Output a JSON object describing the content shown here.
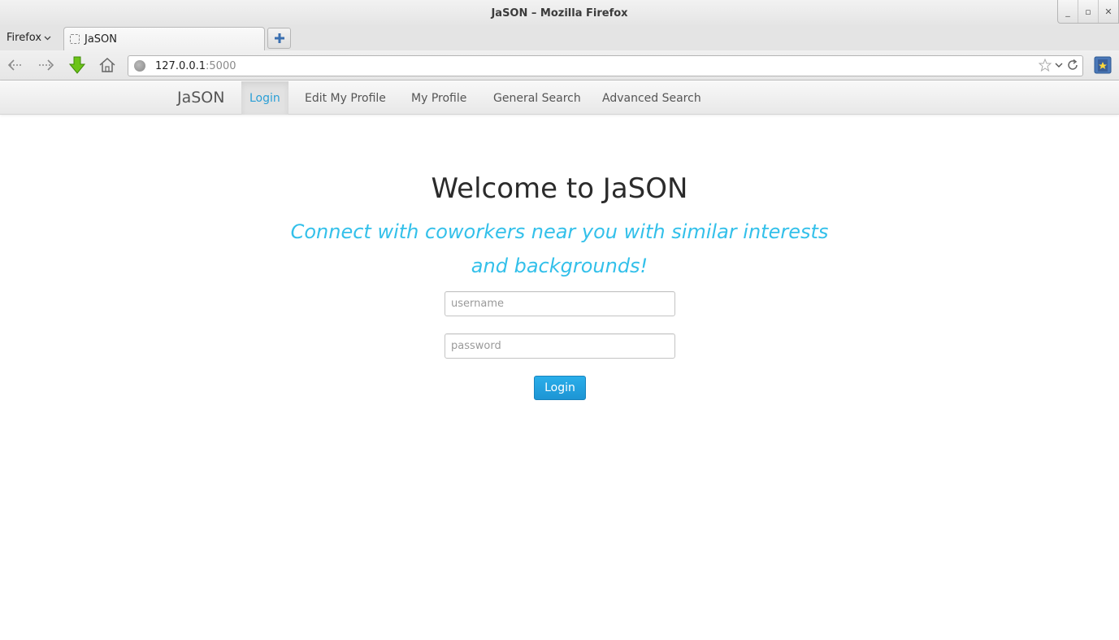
{
  "window": {
    "title": "JaSON – Mozilla Firefox",
    "controls": [
      "minimize-icon",
      "maximize-icon",
      "close-icon"
    ]
  },
  "browser": {
    "menu_label": "Firefox",
    "tab": {
      "label": "JaSON"
    },
    "url": {
      "host": "127.0.0.1",
      "port": ":5000"
    }
  },
  "site_nav": {
    "brand": "JaSON",
    "links": [
      {
        "label": "Login",
        "active": true
      },
      {
        "label": "Edit My Profile",
        "active": false
      },
      {
        "label": "My Profile",
        "active": false
      },
      {
        "label": "General Search",
        "active": false
      },
      {
        "label": "Advanced Search",
        "active": false
      }
    ]
  },
  "hero": {
    "heading": "Welcome to JaSON",
    "tagline": "Connect with coworkers near you with similar interests and backgrounds!"
  },
  "login_form": {
    "username_placeholder": "username",
    "password_placeholder": "password",
    "submit_label": "Login"
  },
  "colors": {
    "accent": "#2a9fd6",
    "tagline": "#33c0ea",
    "button": "#1d95d4"
  }
}
